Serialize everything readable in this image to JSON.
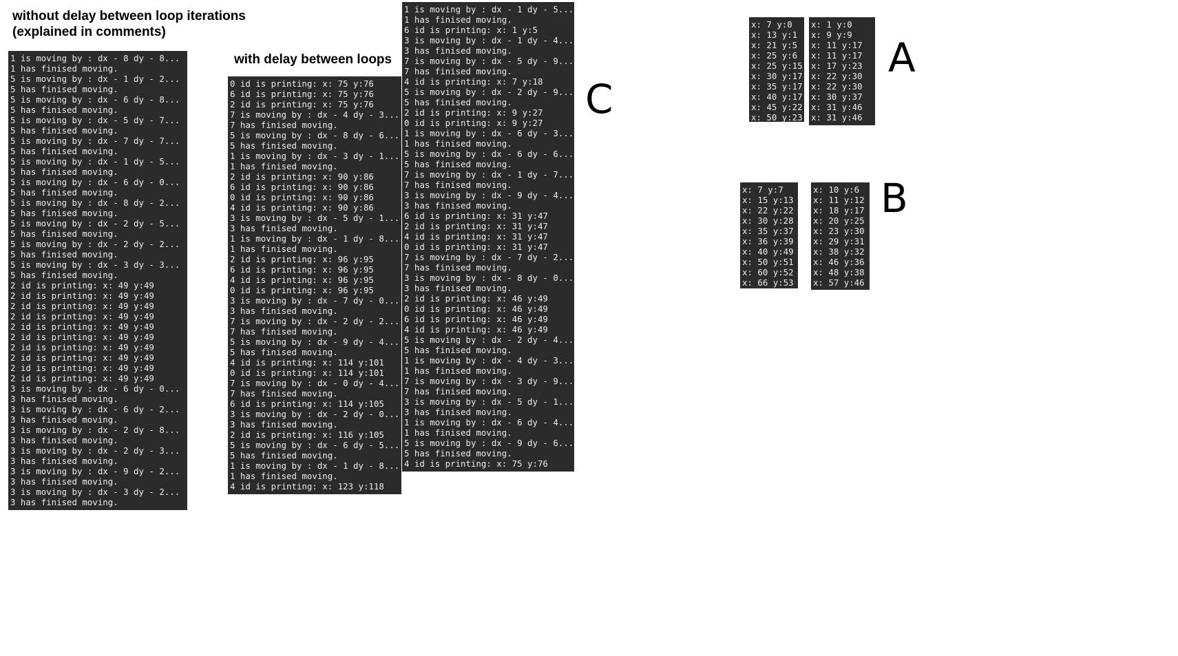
{
  "headings": {
    "without_delay": "without delay between loop iterations\n(explained in comments)",
    "with_delay": "with delay between loops"
  },
  "labels": {
    "a": "A",
    "b": "B",
    "c": "C"
  },
  "colors": {
    "console_bg": "#2b2b2b",
    "console_text": "#ececec",
    "page_bg": "#ffffff"
  },
  "console_no_delay": [
    "1 is moving by : dx - 8 dy - 8...",
    "1 has finised moving.",
    "5 is moving by : dx - 1 dy - 2...",
    "5 has finised moving.",
    "5 is moving by : dx - 6 dy - 8...",
    "5 has finised moving.",
    "5 is moving by : dx - 5 dy - 7...",
    "5 has finised moving.",
    "5 is moving by : dx - 7 dy - 7...",
    "5 has finised moving.",
    "5 is moving by : dx - 1 dy - 5...",
    "5 has finised moving.",
    "5 is moving by : dx - 6 dy - 0...",
    "5 has finised moving.",
    "5 is moving by : dx - 8 dy - 2...",
    "5 has finised moving.",
    "5 is moving by : dx - 2 dy - 5...",
    "5 has finised moving.",
    "5 is moving by : dx - 2 dy - 2...",
    "5 has finised moving.",
    "5 is moving by : dx - 3 dy - 3...",
    "5 has finised moving.",
    "2 id is printing: x: 49 y:49",
    "2 id is printing: x: 49 y:49",
    "2 id is printing: x: 49 y:49",
    "2 id is printing: x: 49 y:49",
    "2 id is printing: x: 49 y:49",
    "2 id is printing: x: 49 y:49",
    "2 id is printing: x: 49 y:49",
    "2 id is printing: x: 49 y:49",
    "2 id is printing: x: 49 y:49",
    "2 id is printing: x: 49 y:49",
    "3 is moving by : dx - 6 dy - 0...",
    "3 has finised moving.",
    "3 is moving by : dx - 6 dy - 2...",
    "3 has finised moving.",
    "3 is moving by : dx - 2 dy - 8...",
    "3 has finised moving.",
    "3 is moving by : dx - 2 dy - 3...",
    "3 has finised moving.",
    "3 is moving by : dx - 9 dy - 2...",
    "3 has finised moving.",
    "3 is moving by : dx - 3 dy - 2...",
    "3 has finised moving."
  ],
  "console_with_delay": [
    "0 id is printing: x: 75 y:76",
    "6 id is printing: x: 75 y:76",
    "2 id is printing: x: 75 y:76",
    "7 is moving by : dx - 4 dy - 3...",
    "7 has finised moving.",
    "5 is moving by : dx - 8 dy - 6...",
    "5 has finised moving.",
    "1 is moving by : dx - 3 dy - 1...",
    "1 has finised moving.",
    "2 id is printing: x: 90 y:86",
    "6 id is printing: x: 90 y:86",
    "0 id is printing: x: 90 y:86",
    "4 id is printing: x: 90 y:86",
    "3 is moving by : dx - 5 dy - 1...",
    "3 has finised moving.",
    "1 is moving by : dx - 1 dy - 8...",
    "1 has finised moving.",
    "2 id is printing: x: 96 y:95",
    "6 id is printing: x: 96 y:95",
    "4 id is printing: x: 96 y:95",
    "0 id is printing: x: 96 y:95",
    "3 is moving by : dx - 7 dy - 0...",
    "3 has finised moving.",
    "7 is moving by : dx - 2 dy - 2...",
    "7 has finised moving.",
    "5 is moving by : dx - 9 dy - 4...",
    "5 has finised moving.",
    "4 id is printing: x: 114 y:101",
    "0 id is printing: x: 114 y:101",
    "7 is moving by : dx - 0 dy - 4...",
    "7 has finised moving.",
    "6 id is printing: x: 114 y:105",
    "3 is moving by : dx - 2 dy - 0...",
    "3 has finised moving.",
    "2 id is printing: x: 116 y:105",
    "5 is moving by : dx - 6 dy - 5...",
    "5 has finised moving.",
    "1 is moving by : dx - 1 dy - 8...",
    "1 has finised moving.",
    "4 id is printing: x: 123 y:118"
  ],
  "console_c": [
    "1 is moving by : dx - 1 dy - 5...",
    "1 has finised moving.",
    "6 id is printing: x: 1 y:5",
    "3 is moving by : dx - 1 dy - 4...",
    "3 has finised moving.",
    "7 is moving by : dx - 5 dy - 9...",
    "7 has finised moving.",
    "4 id is printing: x: 7 y:18",
    "5 is moving by : dx - 2 dy - 9...",
    "5 has finised moving.",
    "2 id is printing: x: 9 y:27",
    "0 id is printing: x: 9 y:27",
    "1 is moving by : dx - 6 dy - 3...",
    "1 has finised moving.",
    "5 is moving by : dx - 6 dy - 6...",
    "5 has finised moving.",
    "7 is moving by : dx - 1 dy - 7...",
    "7 has finised moving.",
    "3 is moving by : dx - 9 dy - 4...",
    "3 has finised moving.",
    "6 id is printing: x: 31 y:47",
    "2 id is printing: x: 31 y:47",
    "4 id is printing: x: 31 y:47",
    "0 id is printing: x: 31 y:47",
    "7 is moving by : dx - 7 dy - 2...",
    "7 has finised moving.",
    "3 is moving by : dx - 8 dy - 0...",
    "3 has finised moving.",
    "2 id is printing: x: 46 y:49",
    "0 id is printing: x: 46 y:49",
    "6 id is printing: x: 46 y:49",
    "4 id is printing: x: 46 y:49",
    "5 is moving by : dx - 2 dy - 4...",
    "5 has finised moving.",
    "1 is moving by : dx - 4 dy - 3...",
    "1 has finised moving.",
    "7 is moving by : dx - 3 dy - 9...",
    "7 has finised moving.",
    "3 is moving by : dx - 5 dy - 1...",
    "3 has finised moving.",
    "1 is moving by : dx - 6 dy - 4...",
    "1 has finised moving.",
    "5 is moving by : dx - 9 dy - 6...",
    "5 has finised moving.",
    "4 id is printing: x: 75 y:76"
  ],
  "console_a_left": [
    "x: 7 y:0",
    "x: 13 y:1",
    "x: 21 y:5",
    "x: 25 y:6",
    "x: 25 y:15",
    "x: 30 y:17",
    "x: 35 y:17",
    "x: 40 y:17",
    "x: 45 y:22",
    "x: 50 y:23"
  ],
  "console_a_right": [
    "x: 1 y:0",
    "x: 9 y:9",
    "x: 11 y:17",
    "x: 11 y:17",
    "x: 17 y:23",
    "x: 22 y:30",
    "x: 22 y:30",
    "x: 30 y:37",
    "x: 31 y:46",
    "x: 31 y:46"
  ],
  "console_b_left": [
    "x: 7 y:7",
    "x: 15 y:13",
    "x: 22 y:22",
    "x: 30 y:28",
    "x: 35 y:37",
    "x: 36 y:39",
    "x: 40 y:49",
    "x: 50 y:51",
    "x: 60 y:52",
    "x: 66 y:53"
  ],
  "console_b_right": [
    "x: 10 y:6",
    "x: 11 y:12",
    "x: 18 y:17",
    "x: 20 y:25",
    "x: 23 y:30",
    "x: 29 y:31",
    "x: 38 y:32",
    "x: 46 y:36",
    "x: 48 y:38",
    "x: 57 y:46"
  ]
}
